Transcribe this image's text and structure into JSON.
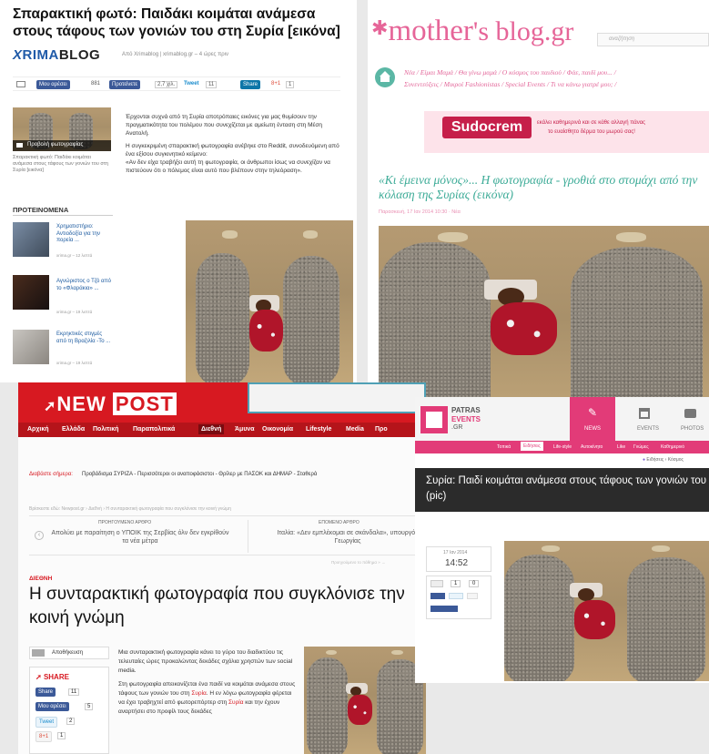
{
  "xrima": {
    "headline": "Σπαρακτική φωτό: Παιδάκι κοιμάται ανάμεσα στους τάφους των γονιών του στη Συρία [εικόνα]",
    "logo_x": "X",
    "logo_rest": "RIMA",
    "logo_blog": "BLOG",
    "byline": "Από Xrimablog | xrimablog.gr – 4 ώρες πριν",
    "share_like": "Μου αρέσει",
    "share_like_count": "881",
    "share_rec": "Προτείνετε",
    "share_rec_count": "2,7 χιλ.",
    "tweet": "Tweet",
    "tweet_count": "11",
    "share_in": "Share",
    "gplus": "8+1",
    "gplus_count": "1",
    "side_caption_badge": "Προβολή φωτογραφίας",
    "side_caption": "Σπαρακτική φωτό: Παιδάκι κοιμάται ανάμεσα στους τάφους των γονιών του στη Συρία [εικόνα]",
    "p1": "Έρχονται συχνά από τη Συρία αποτρόπαιες εικόνες για μας θυμίσουν την πραγματικότητα του πολέμου που συνεχίζεται με αμείωτη ένταση στη Μέση Ανατολή.",
    "p2": "Η συγκεκριμένη σπαρακτική φωτογραφία ανέβηκε στο Reddit, συνοδευόμενη από ένα εξίσου συγκινητικό κείμενο:",
    "p3": "«Αν δεν είχα τραβήξει αυτή τη φωτογραφία, οι άνθρωποι ίσως να συνεχίζαν να πιστεύουν ότι ο πόλεμος είναι αυτό που βλέπουν στην τηλεόραση».",
    "proteinomena": "ΠΡΟΤΕΙΝΟΜΕΝΑ",
    "rec": [
      {
        "title": "Χρηματιστήριο: Αντιοδοξία για την πορεία ...",
        "meta": "xrima.gr – 12 λεπτά"
      },
      {
        "title": "Αγνώριστος ο Τζό από το «Φλαράκια» ...",
        "meta": "xrima.gr – 19 λεπτά"
      },
      {
        "title": "Εκρηκτικές στιγμές από τη Βραζιλία -Το ...",
        "meta": "xrima.gr – 19 λεπτά"
      }
    ]
  },
  "mothers": {
    "logo_pre": "mother",
    "logo_post": "'s blog.gr",
    "search_ph": "αναζήτηση",
    "nav1": "Νέα / Είμαι Μαμά / Θα γίνω μαμά / Ο κόσμος του παιδιού / Φάε, παιδί μου... /",
    "nav2": "Συνεντεύξεις / Μικροί Fashionistas / Special Events / Τι να κάνω γιατρέ μου; /",
    "ad_brand": "Sudocrem",
    "ad_text1": "εκάλει καθημερινά και σε κάθε αλλαγή πάνας",
    "ad_text2": "το ευαίσθητο δέρμα του μωρού σας!",
    "headline": "«Κι έμεινα μόνος»... Η φωτογραφία - γροθιά στο στομάχι από την κόλαση της Συρίας (εικόνα)",
    "meta": "Παρασκευή, 17 Ιαν 2014 10:30 · Νέα"
  },
  "newpost": {
    "logo_new": "NEW",
    "logo_post": "POST",
    "nav": [
      "Αρχική",
      "Ελλάδα",
      "Πολιτική",
      "Παραπολιτικά",
      "Διεθνή",
      "Άμυνα",
      "Οικονομία",
      "Lifestyle",
      "Media",
      "Προ"
    ],
    "ticker_label": "Διαβάστε σήμερα:",
    "ticker": "Προβάδισμα ΣΥΡΙΖΑ - Περισσότεροι οι αναποφάσιστοι - Θρίλερ με ΠΑΣΟΚ και ΔΗΜΑΡ - Σταθερά",
    "breadcrumb": "Βρίσκεστε εδώ: Newpost.gr › Διεθνή › Η συνταρακτική φωτογραφία που συγκλόνισε την κοινή γνώμη",
    "prev_label": "ΠΡΟΗΓΟΥΜΕΝΟ ΑΡΘΡΟ",
    "prev_text": "Απολύει με παραίτηση ο ΥΠΟΙΚ της Σερβίας όλν δεν εγκρίθούν τα νέα μέτρα",
    "next_label": "ΕΠΟΜΕΝΟ ΑΡΘΡΟ",
    "next_text": "Ιταλία: «Δεν εμπλέκομαι σε σκάνδαλα», υπουργός Γεωργίας",
    "next_more": "Προηγούμενο το πάθημα » →",
    "section": "ΔΙΕΘΝΗ",
    "headline1": "Η συνταρακτική φωτογραφία που συγκλόνισε την",
    "headline2": "κοινή γνώμη",
    "print": "Αποθήκευση",
    "share": "SHARE",
    "b_like": "Share",
    "b_like_n": "11",
    "b_rec": "Μου αρέσει",
    "b_rec_n": "5",
    "b_tweet": "Tweet",
    "b_tweet_n": "2",
    "b_g": "8+1",
    "b_g_n": "1",
    "p1": "Μια συνταρακτική φωτογραφία κάνει το γύρο του διαδικτύου τις τελευταίες ώρες προκαλώντας δεκάδες σχόλια χρηστών των social media.",
    "p2a": "Στη φωτογραφία απεικονίζεται ένα παιδί να κοιμάται ανάμεσα στους τάφους των γονιών του στη ",
    "p2link": "Συρία",
    "p3a": ". Η εν λόγω φωτογραφία φέρεται να έχει τραβηχτεί από φωτορεπόρτερ στη ",
    "p3link": "Συρία",
    "p4": " και την έχουν αναρτήσει στο προφίλ τους δεκάδες"
  },
  "patras": {
    "logo1": "PATRAS",
    "logo2": "EVENTS",
    "logo3": ".GR",
    "tabs": [
      "NEWS",
      "EVENTS",
      "PHOTOS"
    ],
    "nav": [
      "Τοπικά",
      "Ειδήσεις",
      "Life-style",
      "Αυτοκίνητο",
      "Like",
      "Γνώμες",
      "Καθημερινό"
    ],
    "crumb": "Ειδήσεις › Κόσμος",
    "headline": "Συρία: Παιδί κοιμάται ανάμεσα στους τάφους των γονιών του (pic)",
    "date": "17 Ιαν 2014",
    "time": "14:52",
    "c1": "1",
    "c2": "0"
  }
}
